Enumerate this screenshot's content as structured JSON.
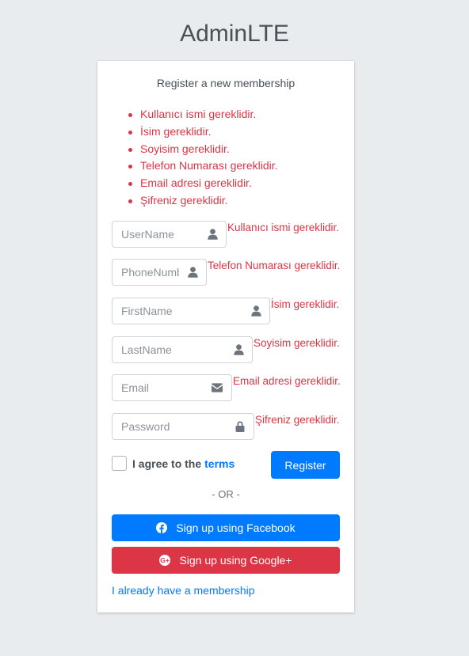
{
  "logo": {
    "bold": "Admin",
    "light": "LTE"
  },
  "card": {
    "message": "Register a new membership"
  },
  "errors": [
    "Kullanıcı ismi gereklidir.",
    "İsim gereklidir.",
    "Soyisim gereklidir.",
    "Telefon Numarası gereklidir.",
    "Email adresi gereklidir.",
    "Şifreniz gereklidir."
  ],
  "fields": {
    "username": {
      "placeholder": "UserName",
      "value": "",
      "icon": "user-icon",
      "error": "Kullanıcı ismi gereklidir."
    },
    "phone": {
      "placeholder": "PhoneNumber",
      "value": "",
      "icon": "user-icon",
      "error": "Telefon Numarası gereklidir."
    },
    "firstname": {
      "placeholder": "FirstName",
      "value": "",
      "icon": "user-icon",
      "error": "İsim gereklidir."
    },
    "lastname": {
      "placeholder": "LastName",
      "value": "",
      "icon": "user-icon",
      "error": "Soyisim gereklidir."
    },
    "email": {
      "placeholder": "Email",
      "value": "",
      "icon": "envelope-icon",
      "error": "Email adresi gereklidir."
    },
    "password": {
      "placeholder": "Password",
      "value": "",
      "icon": "lock-icon",
      "error": "Şifreniz gereklidir."
    }
  },
  "terms": {
    "label": "I agree to the",
    "link": "terms",
    "checked": false
  },
  "register_button": "Register",
  "or_text": "- OR -",
  "social": {
    "facebook": {
      "label": "Sign up using Facebook",
      "icon": "facebook-icon"
    },
    "google": {
      "label": "Sign up using Google+",
      "icon": "google-plus-icon"
    }
  },
  "login_link": "I already have a membership",
  "colors": {
    "primary": "#007bff",
    "danger": "#dc3545",
    "background": "#e9ecef",
    "text": "#495057"
  }
}
